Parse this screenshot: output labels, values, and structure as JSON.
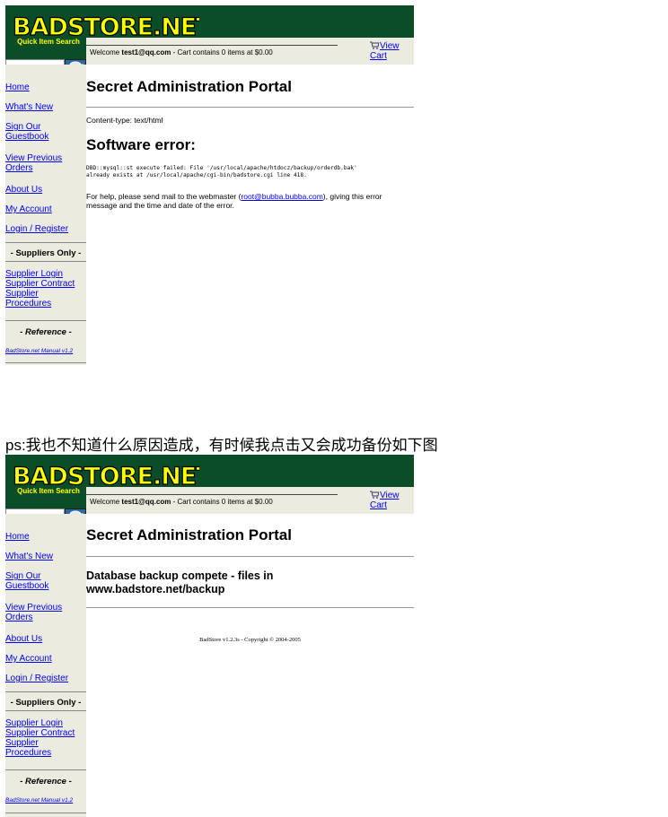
{
  "site": {
    "brand": "BADSTORE.NET",
    "brand_colors": {
      "banner": "#0b4d28",
      "logo_fill": "#ffff00",
      "sidebar": "#ecebdf",
      "link": "#0000ee"
    },
    "quick_search_label": "Quick Item Search",
    "welcome_prefix": "Welcome ",
    "welcome_user": "test1@qq.com",
    "welcome_suffix": " - Cart contains 0 items at $0.00",
    "view_label": "View",
    "cart_label": "Cart",
    "nav": [
      {
        "name": "home",
        "line1": "Home",
        "line2": ""
      },
      {
        "name": "whats-new",
        "line1": "What's New",
        "line2": ""
      },
      {
        "name": "guestbook",
        "line1": "Sign Our",
        "line2": "Guestbook"
      },
      {
        "name": "previous-orders",
        "line1": "View Previous",
        "line2": "Orders"
      },
      {
        "name": "about-us",
        "line1": "About Us",
        "line2": ""
      },
      {
        "name": "my-account",
        "line1": "My Account",
        "line2": ""
      },
      {
        "name": "login-register",
        "line1": "Login / Register",
        "line2": ""
      }
    ],
    "suppliers_heading": "- Suppliers Only -",
    "supplier_links": [
      "Supplier Login",
      "Supplier Contract",
      "Supplier",
      "Procedures"
    ],
    "reference_heading": "- Reference -",
    "manual_link": "BadStore.net Manual v1.2"
  },
  "shot1": {
    "page_title": "Secret Administration Portal",
    "content_type": "Content-type: text/html",
    "error_title": "Software error:",
    "error_line1": "DBD::mysql::st execute failed: File '/usr/local/apache/htdocz/backup/orderdb.bak'",
    "error_line2": "already exists at /usr/local/apache/cgi-bin/badstore.cgi line 418.",
    "help_prefix": "For help, please send mail to the webmaster (",
    "help_email": "root@bubba.bubba.com",
    "help_suffix": "), giving this error message and the time and date of the error."
  },
  "caption": "ps:我也不知道什么原因造成，有时候我点击又会成功备份如下图",
  "shot2": {
    "page_title": "Secret Administration Portal",
    "backup_line1": "Database backup compete - files in",
    "backup_line2": "www.badstore.net/backup",
    "copyright": "BadStore v1.2.3s - Copyright © 2004-2005"
  }
}
